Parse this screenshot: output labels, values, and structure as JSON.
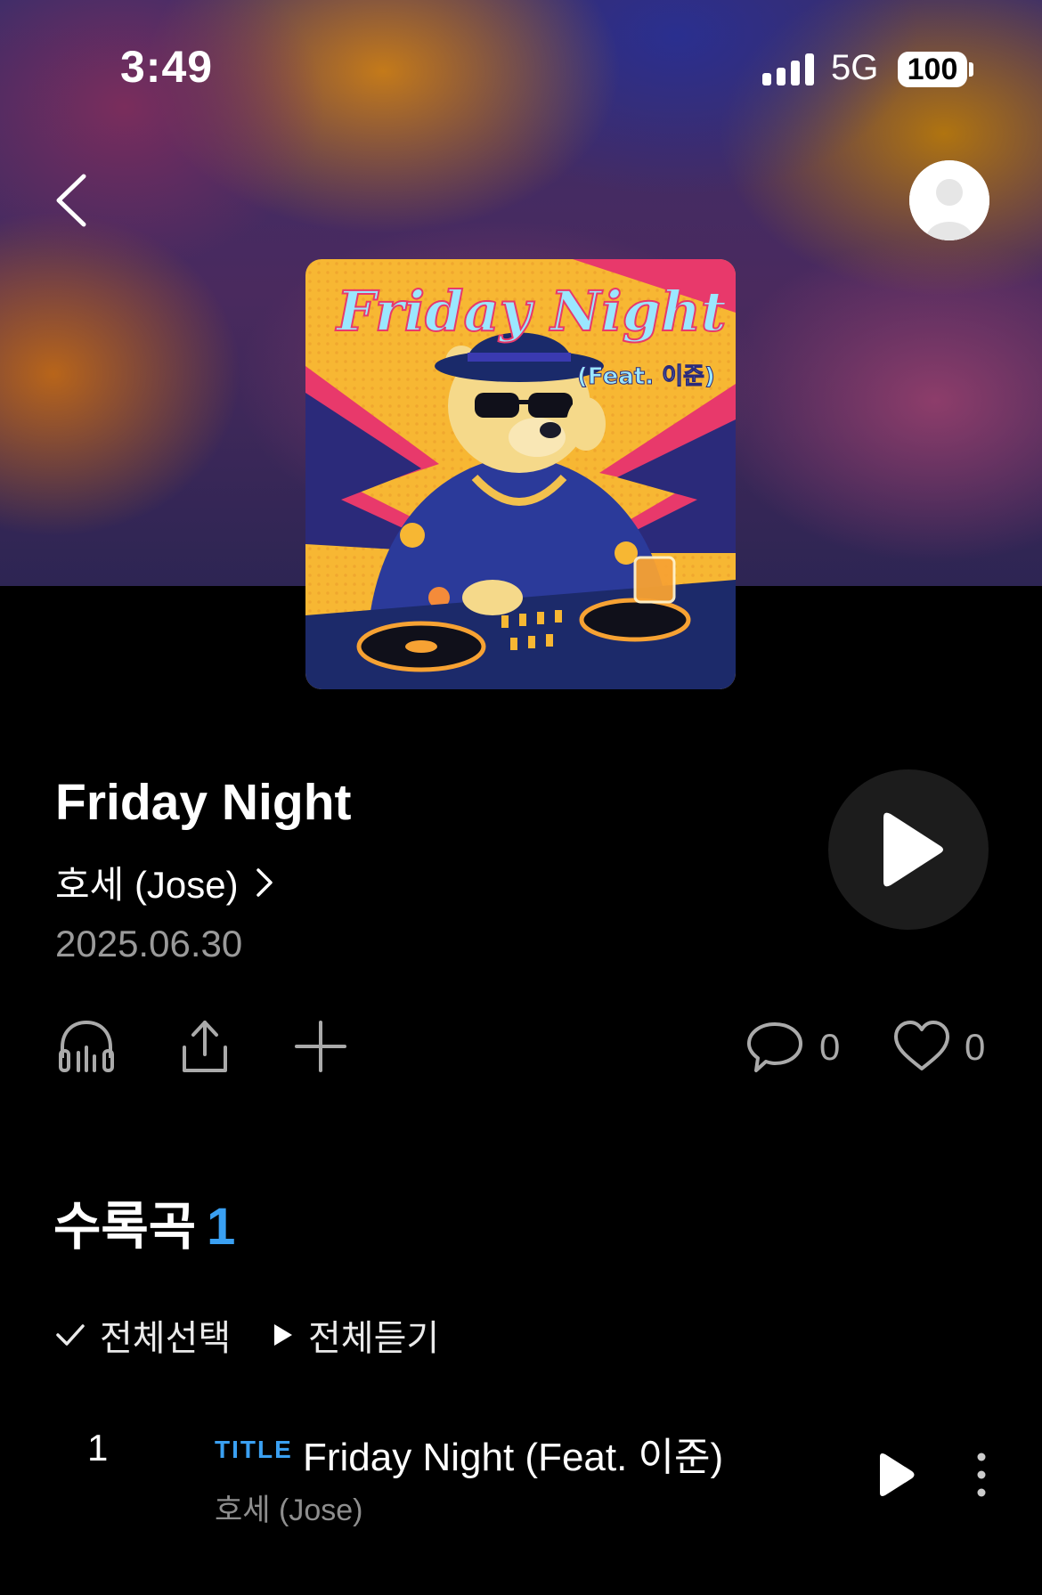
{
  "status_bar": {
    "time": "3:49",
    "network": "5G",
    "battery": "100"
  },
  "nav": {
    "back_icon": "chevron-left-icon",
    "profile_icon": "avatar-icon"
  },
  "album": {
    "cover_text_main": "Friday Night",
    "cover_text_feat": "(Feat. 이준)",
    "title": "Friday Night",
    "artist": "호세 (Jose)",
    "release_date": "2025.06.30"
  },
  "actions": {
    "listen_icon": "headphones-icon",
    "share_icon": "share-icon",
    "add_icon": "plus-icon",
    "comment_count": "0",
    "like_count": "0"
  },
  "tracks_section": {
    "title": "수록곡",
    "count": "1",
    "select_all": "전체선택",
    "play_all": "전체듣기"
  },
  "tracks": [
    {
      "number": "1",
      "badge": "TITLE",
      "title": "Friday Night (Feat. 이준)",
      "artist": "호세 (Jose)"
    }
  ],
  "colors": {
    "accent": "#3aa0f2",
    "background": "#000000",
    "secondary_text": "#9a9a9a"
  }
}
